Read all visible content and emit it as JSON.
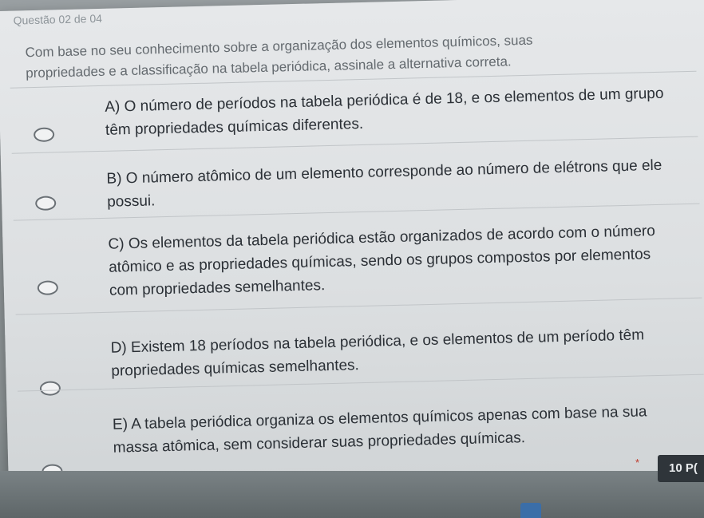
{
  "question": {
    "number_label": "Questão 02 de 04",
    "statement": "Com base no seu conhecimento sobre a organização dos elementos químicos, suas propriedades e a classificação na tabela periódica, assinale a alternativa correta."
  },
  "options": [
    {
      "text": "A) O número de períodos na tabela periódica é de 18, e os elementos de um grupo têm propriedades químicas diferentes."
    },
    {
      "text": "B) O número atômico de um elemento corresponde ao número de elétrons que ele possui."
    },
    {
      "text": "C) Os elementos da tabela periódica estão organizados de acordo com o número atômico e as propriedades químicas, sendo os grupos compostos por elementos com propriedades semelhantes."
    },
    {
      "text": "D) Existem 18 períodos na tabela periódica, e os elementos de um período têm propriedades químicas semelhantes."
    },
    {
      "text": "E) A tabela periódica organiza os elementos químicos apenas com base na sua massa atômica, sem considerar suas propriedades químicas."
    }
  ],
  "footer": {
    "star": "*",
    "next_partial_label": "10 P("
  }
}
